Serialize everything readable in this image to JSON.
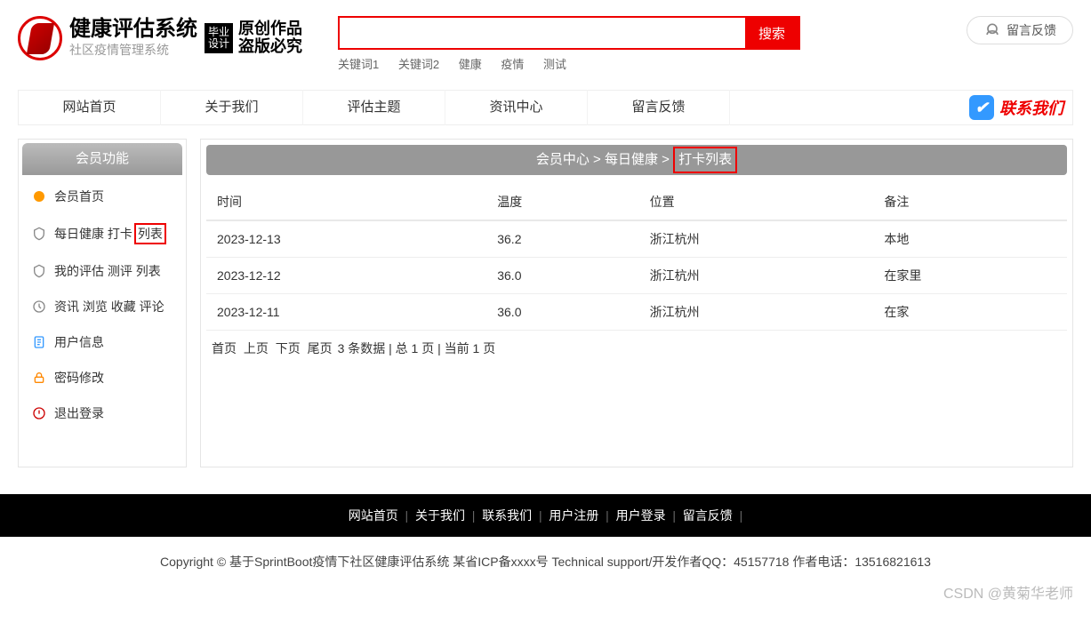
{
  "header": {
    "title": "健康评估系统",
    "subtitle": "社区疫情管理系统",
    "badge": "毕业\n设计",
    "handwrite1": "原创作品",
    "handwrite2": "盗版必究"
  },
  "search": {
    "placeholder": "",
    "button": "搜索",
    "keywords": [
      "关键词1",
      "关键词2",
      "健康",
      "疫情",
      "测试"
    ]
  },
  "feedback_button": "留言反馈",
  "nav": {
    "items": [
      "网站首页",
      "关于我们",
      "评估主题",
      "资讯中心",
      "留言反馈"
    ],
    "contact": "联系我们"
  },
  "sidebar": {
    "title": "会员功能",
    "items": [
      {
        "icon": "home",
        "label": "会员首页",
        "color": "#f90"
      },
      {
        "icon": "shield",
        "label_pre": "每日健康 打卡",
        "label_hl": "列表",
        "color": "#888"
      },
      {
        "icon": "shield",
        "label": "我的评估 测评 列表",
        "color": "#888"
      },
      {
        "icon": "clock",
        "label": "资讯 浏览 收藏 评论",
        "color": "#888"
      },
      {
        "icon": "doc",
        "label": "用户信息",
        "color": "#39f"
      },
      {
        "icon": "lock",
        "label": "密码修改",
        "color": "#f80"
      },
      {
        "icon": "power",
        "label": "退出登录",
        "color": "#c00"
      }
    ]
  },
  "breadcrumb": {
    "parts": [
      "会员中心",
      "每日健康"
    ],
    "highlight": "打卡列表",
    "sep": ">"
  },
  "table": {
    "headers": [
      "时间",
      "温度",
      "位置",
      "备注"
    ],
    "rows": [
      [
        "2023-12-13",
        "36.2",
        "浙江杭州",
        "本地"
      ],
      [
        "2023-12-12",
        "36.0",
        "浙江杭州",
        "在家里"
      ],
      [
        "2023-12-11",
        "36.0",
        "浙江杭州",
        "在家"
      ]
    ]
  },
  "pager": {
    "links": [
      "首页",
      "上页",
      "下页",
      "尾页"
    ],
    "info": "3 条数据 | 总 1 页 | 当前 1 页"
  },
  "footer": {
    "links": [
      "网站首页",
      "关于我们",
      "联系我们",
      "用户注册",
      "用户登录",
      "留言反馈"
    ],
    "copyright": "Copyright © 基于SprintBoot疫情下社区健康评估系统   某省ICP备xxxx号    Technical support/开发作者QQ：45157718    作者电话：13516821613"
  },
  "watermark": "CSDN @黄菊华老师"
}
